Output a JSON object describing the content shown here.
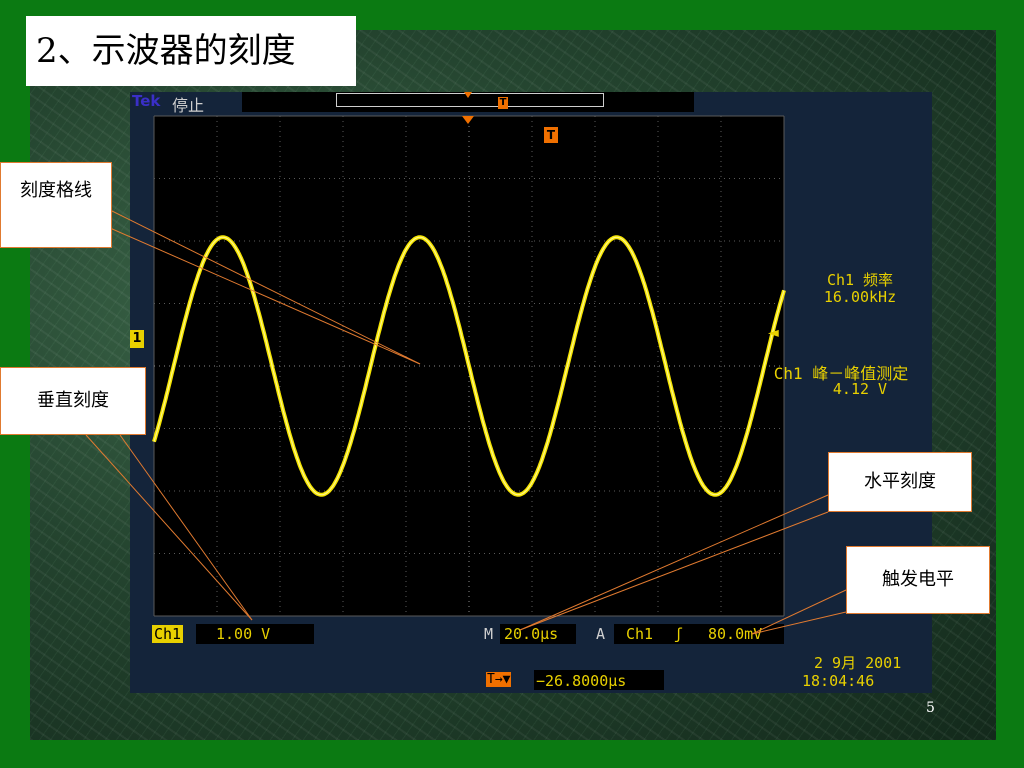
{
  "slide": {
    "title": "2、示波器的刻度",
    "page_number": "5"
  },
  "scope": {
    "brand": "Tek",
    "run_state": "停止",
    "trigger_marker": "T",
    "channel_marker": "1",
    "trigger_level_marker": "◄",
    "measurements": {
      "freq_label": "Ch1 频率",
      "freq_value": "16.00kHz",
      "pp_label": "Ch1 峰－峰值测定",
      "pp_value": "4.12 V"
    },
    "vertical": {
      "channel": "Ch1",
      "scale": "1.00 V"
    },
    "horizontal": {
      "prefix": "M",
      "scale": "20.0μs"
    },
    "trigger": {
      "prefix": "A",
      "channel": "Ch1",
      "slope": "ʃ",
      "level": "80.0mV"
    },
    "trigger_offset": {
      "icon": "T→▼",
      "value": "−26.8000μs"
    },
    "date": "2 9月  2001",
    "time": "18:04:46"
  },
  "callouts": {
    "graticule": "刻度格线",
    "vertical_scale": "垂直刻度",
    "horizontal_scale": "水平刻度",
    "trigger_level": "触发电平"
  },
  "colors": {
    "waveform": "#f5e500",
    "callout_border": "#e07a30",
    "slide_background": "#0b7a12"
  },
  "chart_data": {
    "type": "line",
    "series": [
      {
        "x_unit": "μs",
        "waveform": "sine",
        "frequency_kHz": 16.0,
        "peak_to_peak_V": 4.12,
        "divisions_horizontal": 10,
        "divisions_vertical": 8,
        "time_per_div_us": 20.0,
        "volts_per_div": 1.0
      }
    ],
    "grid": true
  }
}
